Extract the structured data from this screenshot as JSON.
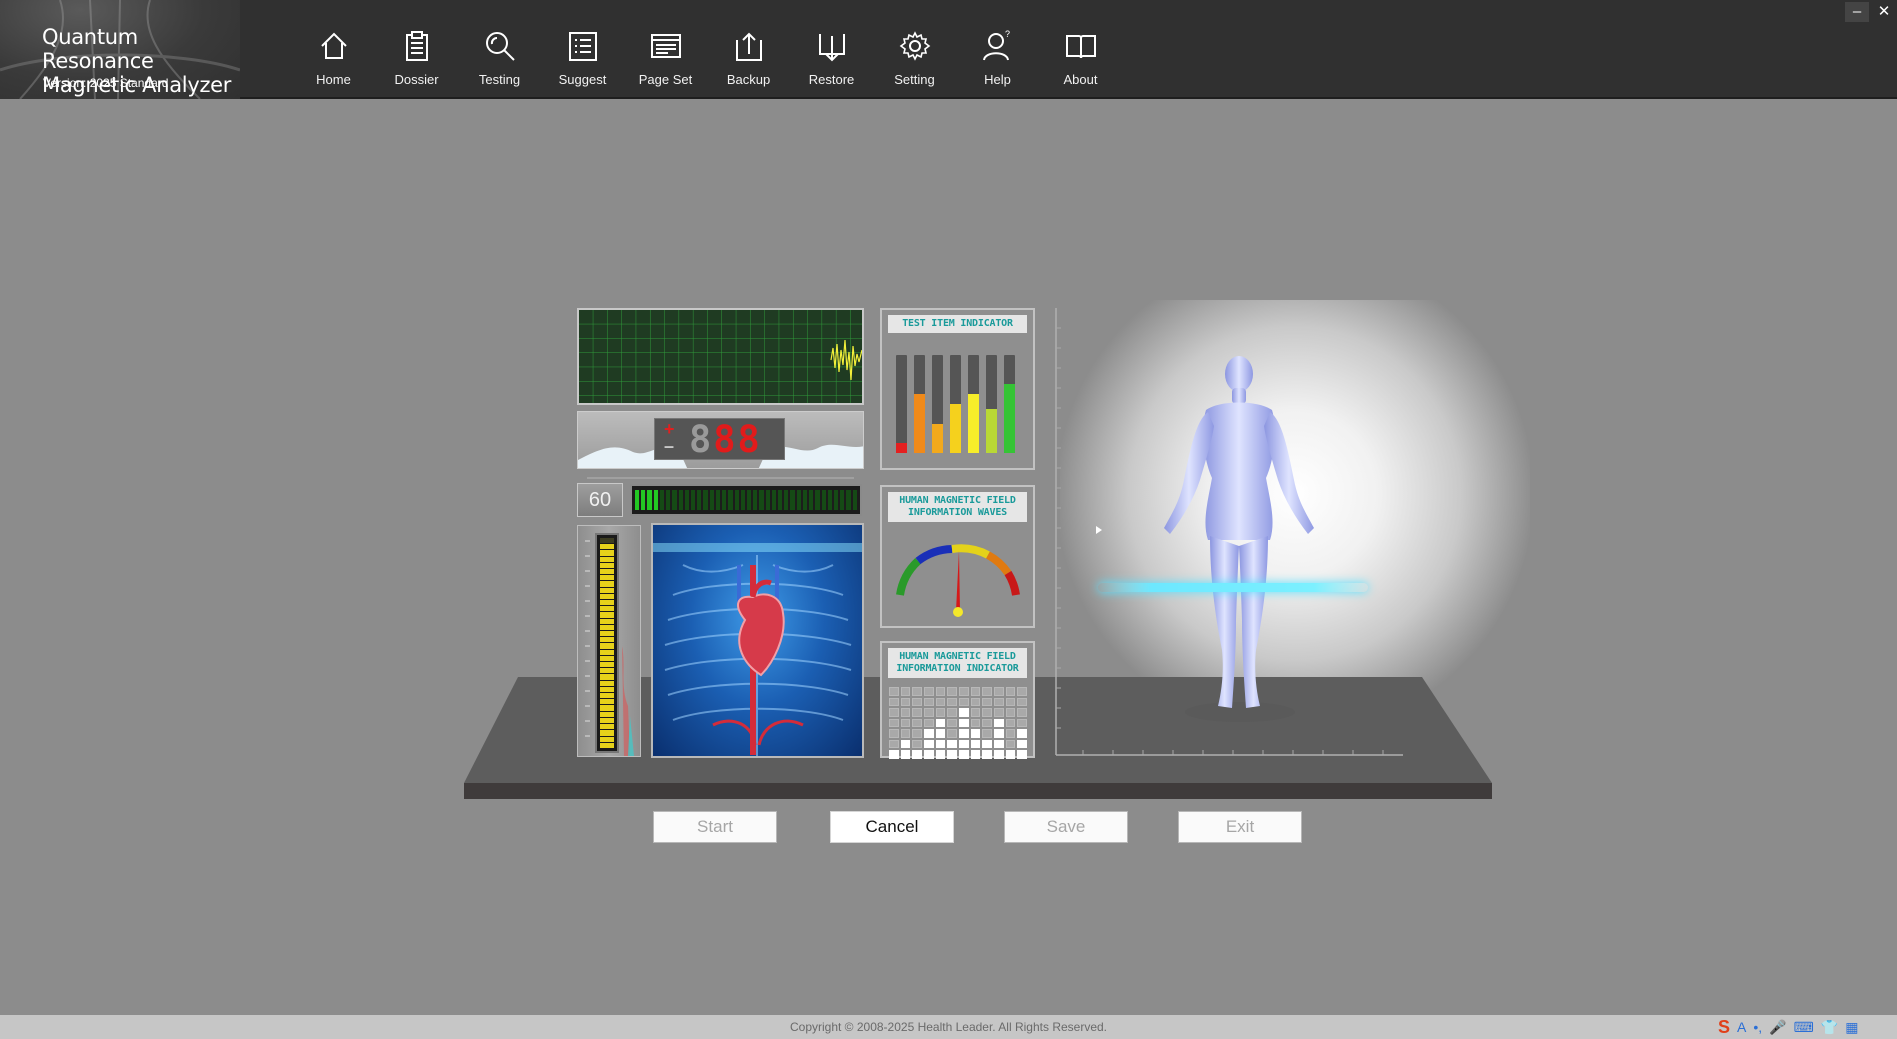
{
  "app": {
    "title_line1": "Quantum Resonance",
    "title_line2": "Magnetic Analyzer",
    "version": "Version: 2025 Standard"
  },
  "nav": [
    {
      "label": "Home",
      "icon": "home-icon"
    },
    {
      "label": "Dossier",
      "icon": "clipboard-icon"
    },
    {
      "label": "Testing",
      "icon": "magnifier-icon"
    },
    {
      "label": "Suggest",
      "icon": "list-icon"
    },
    {
      "label": "Page Set",
      "icon": "page-layout-icon"
    },
    {
      "label": "Backup",
      "icon": "upload-icon"
    },
    {
      "label": "Restore",
      "icon": "download-icon"
    },
    {
      "label": "Setting",
      "icon": "gear-icon"
    },
    {
      "label": "Help",
      "icon": "help-user-icon"
    },
    {
      "label": "About",
      "icon": "book-icon"
    }
  ],
  "window": {
    "minimize": "–",
    "close": "✕"
  },
  "instrument": {
    "counter_sign_plus": "+",
    "counter_sign_minus": "–",
    "counter_digit_dim": "8",
    "counter_digits_lit": "88",
    "frequency_value": "60",
    "level_bar_fraction": 0.1,
    "vertical_meter_fraction": 0.97,
    "test_item_indicator_label": "TEST ITEM INDICATOR",
    "test_item_levels": [
      0.1,
      0.6,
      0.3,
      0.5,
      0.6,
      0.45,
      0.7
    ],
    "test_item_colors": [
      "#e42020",
      "#f08a1a",
      "#f2a91c",
      "#f5d11d",
      "#f7ee2a",
      "#b9d835",
      "#35c435"
    ],
    "waves_label_line1": "HUMAN MAGNETIC FIELD",
    "waves_label_line2": "INFORMATION WAVES",
    "indicator_label_line1": "HUMAN MAGNETIC FIELD",
    "indicator_label_line2": "INFORMATION INDICATOR",
    "indicator_column_heights": [
      1,
      2,
      1,
      3,
      4,
      2,
      5,
      3,
      2,
      4,
      1,
      3
    ]
  },
  "buttons": {
    "start": "Start",
    "cancel": "Cancel",
    "save": "Save",
    "exit": "Exit"
  },
  "footer": {
    "copyright": "Copyright © 2008-2025 Health Leader. All Rights Reserved."
  },
  "tray": [
    "S",
    "A",
    "•,",
    "🎤",
    "⌨",
    "👕",
    "▦"
  ],
  "colors": {
    "header_bg": "#303030",
    "workspace_bg": "#8c8c8c",
    "accent_teal": "#1a9a9a",
    "laser_cyan": "#6de8ff"
  }
}
